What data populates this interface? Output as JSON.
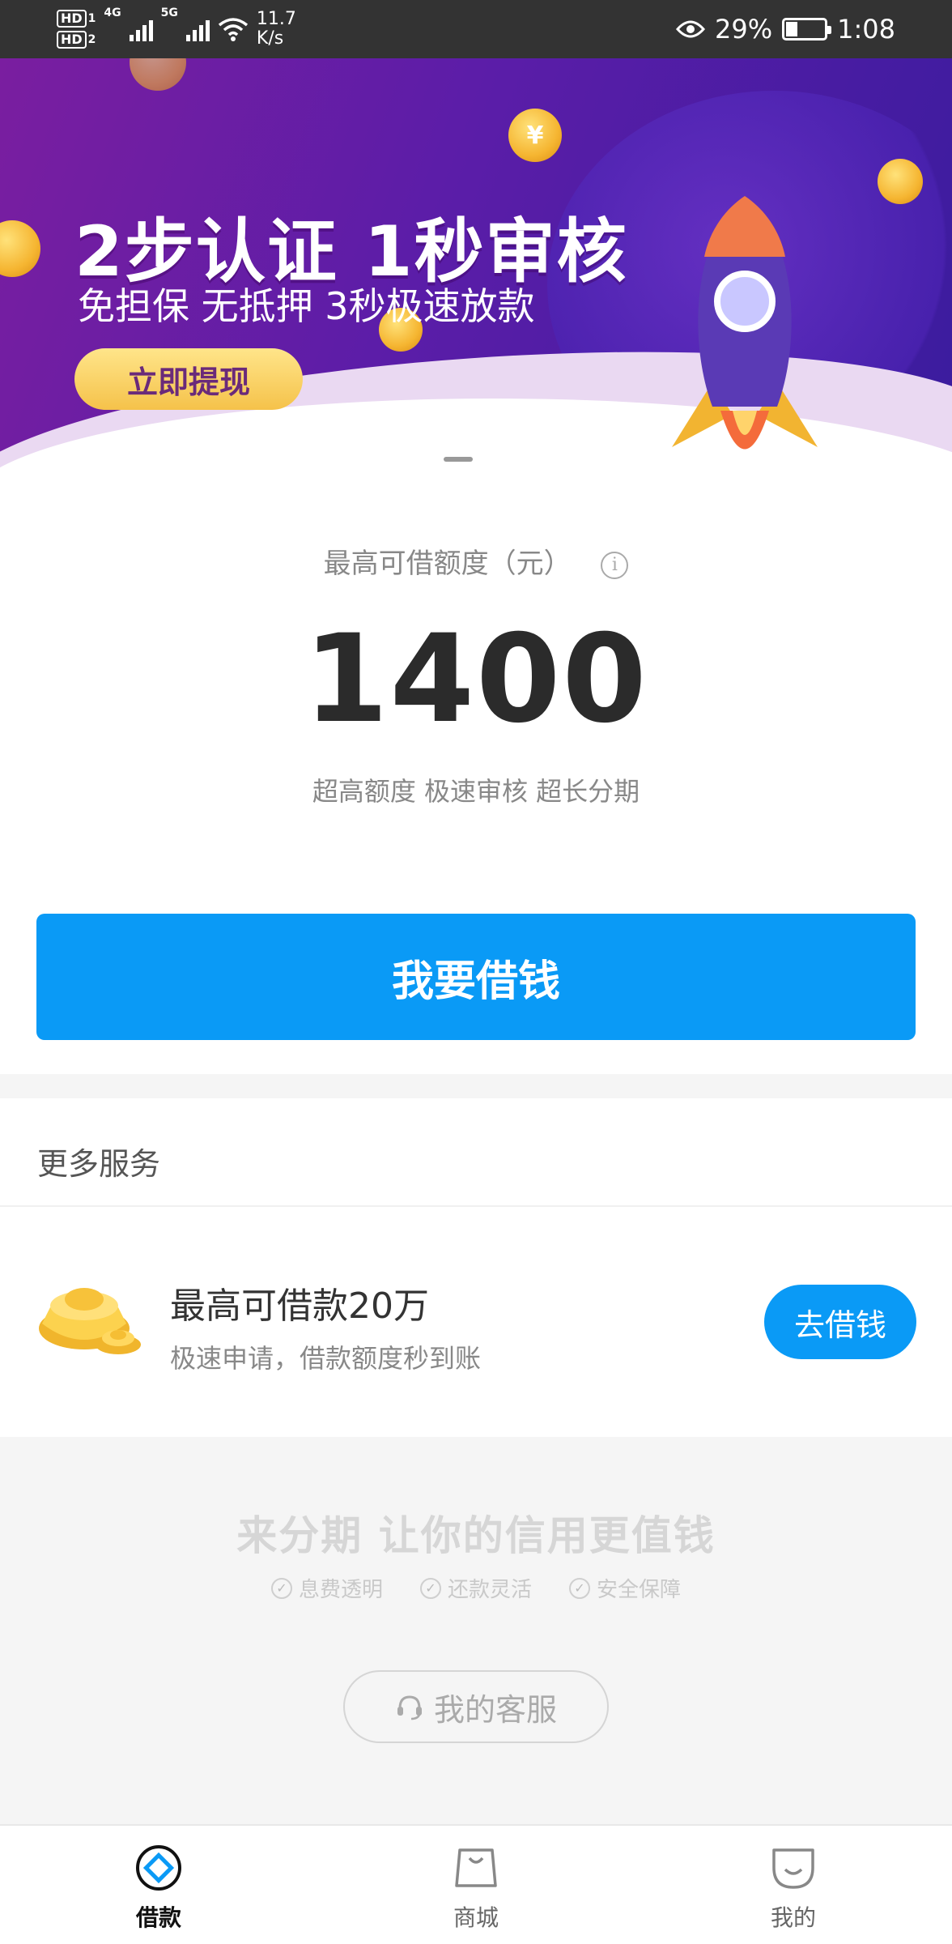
{
  "status_bar": {
    "net1": "HD",
    "net1_sub": "1",
    "net2": "HD",
    "net2_sub": "2",
    "sig1_type": "4G",
    "sig2_type": "5G",
    "speed_value": "11.7",
    "speed_unit": "K/s",
    "battery": "29%",
    "time": "1:08"
  },
  "banner": {
    "title": "2步认证 1秒审核",
    "subtitle": "免担保 无抵押 3秒极速放款",
    "button": "立即提现",
    "coin_symbol": "¥"
  },
  "quota": {
    "label": "最高可借额度（元）",
    "info_symbol": "i",
    "amount": "1400",
    "slogan": "超高额度 极速审核 超长分期",
    "borrow_button": "我要借钱"
  },
  "more_services": {
    "title": "更多服务",
    "item": {
      "title": "最高可借款20万",
      "subtitle": "极速申请，借款额度秒到账",
      "button": "去借钱"
    }
  },
  "promo": {
    "title": "来分期 让你的信用更值钱",
    "features": [
      "息费透明",
      "还款灵活",
      "安全保障"
    ],
    "check_symbol": "✓",
    "service_button": "我的客服"
  },
  "tabs": [
    {
      "label": "借款",
      "icon": "loan-icon",
      "active": true
    },
    {
      "label": "商城",
      "icon": "shop-icon",
      "active": false
    },
    {
      "label": "我的",
      "icon": "profile-icon",
      "active": false
    }
  ],
  "colors": {
    "accent": "#0a9af6",
    "banner_purple": "#5b1da8",
    "status_bar": "#333333"
  }
}
